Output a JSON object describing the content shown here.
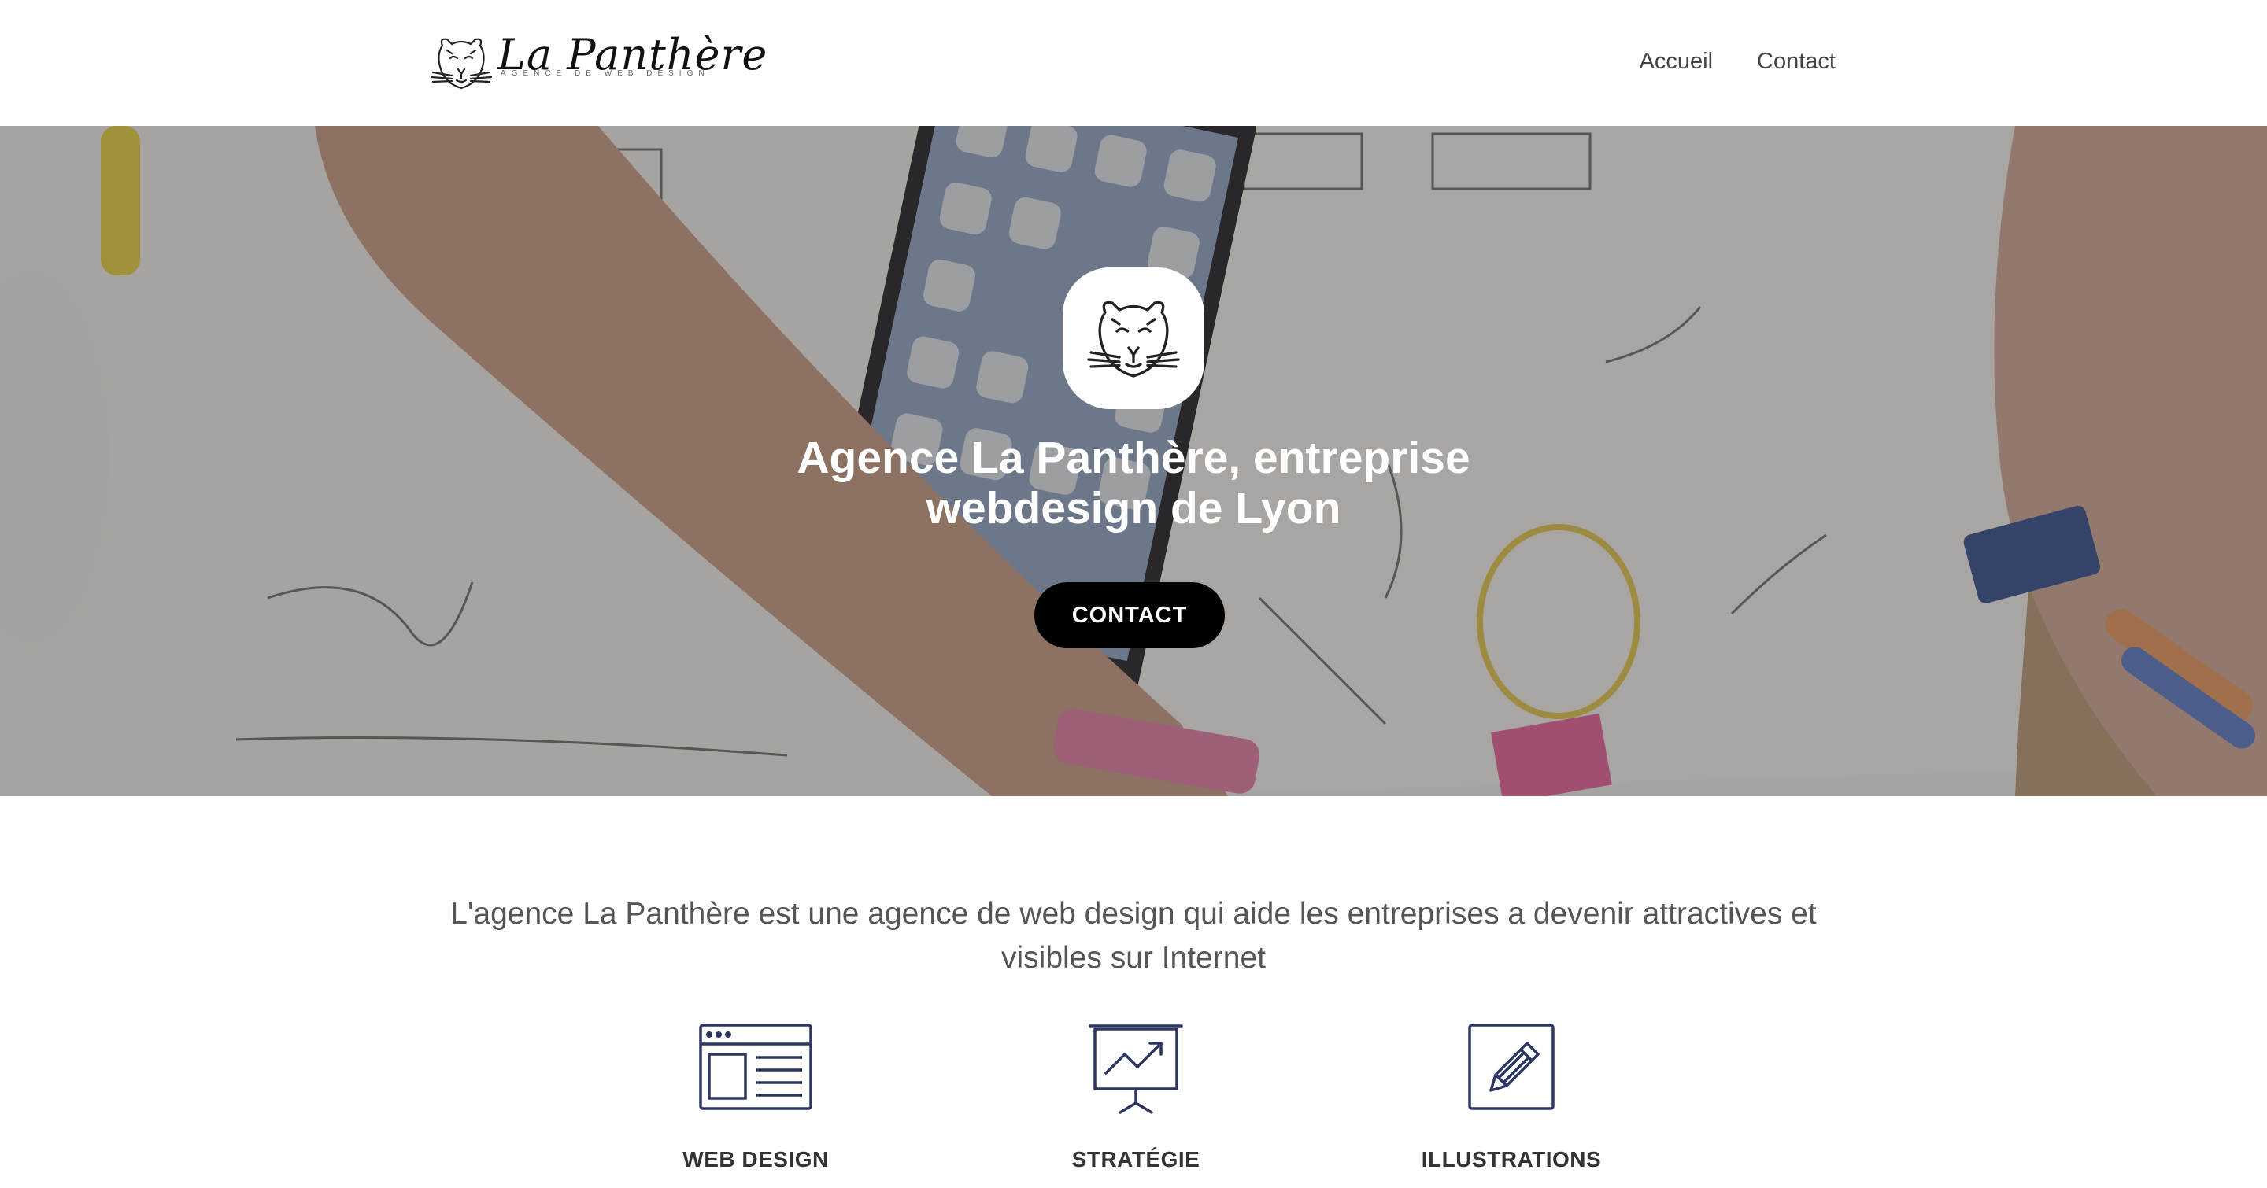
{
  "header": {
    "logo_title": "La Panthère",
    "logo_subtitle": "AGENCE DE WEB DESIGN",
    "nav": [
      {
        "label": "Accueil"
      },
      {
        "label": "Contact"
      }
    ]
  },
  "hero": {
    "title": "Agence La Panthère, entreprise webdesign de Lyon",
    "button_label": "CONTACT"
  },
  "intro": {
    "text": "L'agence La Panthère est une agence de web design qui aide les entreprises a devenir attractives et visibles sur Internet"
  },
  "services": [
    {
      "label": "WEB DESIGN",
      "icon": "browser-window-icon"
    },
    {
      "label": "STRATÉGIE",
      "icon": "presentation-chart-icon"
    },
    {
      "label": "ILLUSTRATIONS",
      "icon": "pencil-icon"
    }
  ],
  "colors": {
    "icon_stroke": "#2d3561",
    "button_bg": "#000000",
    "text": "#555555"
  }
}
